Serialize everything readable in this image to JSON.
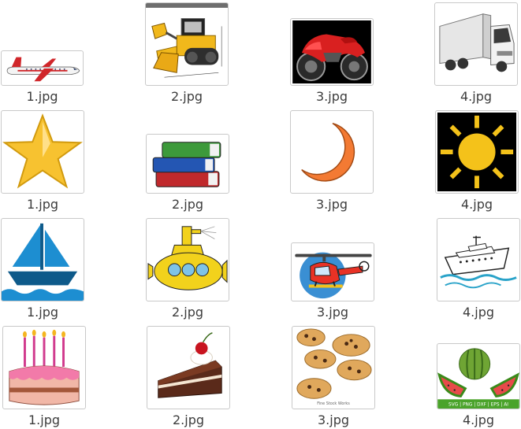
{
  "files": [
    {
      "name": "1.jpg",
      "icon": "airplane-icon"
    },
    {
      "name": "2.jpg",
      "icon": "bulldozer-icon"
    },
    {
      "name": "3.jpg",
      "icon": "motorcycle-icon"
    },
    {
      "name": "4.jpg",
      "icon": "truck-icon"
    },
    {
      "name": "1.jpg",
      "icon": "star-icon"
    },
    {
      "name": "2.jpg",
      "icon": "books-icon"
    },
    {
      "name": "3.jpg",
      "icon": "moon-icon"
    },
    {
      "name": "4.jpg",
      "icon": "sun-icon"
    },
    {
      "name": "1.jpg",
      "icon": "sailboat-icon"
    },
    {
      "name": "2.jpg",
      "icon": "submarine-icon"
    },
    {
      "name": "3.jpg",
      "icon": "helicopter-icon"
    },
    {
      "name": "4.jpg",
      "icon": "cruise-ship-icon"
    },
    {
      "name": "1.jpg",
      "icon": "birthday-cake-icon"
    },
    {
      "name": "2.jpg",
      "icon": "cake-slice-icon"
    },
    {
      "name": "3.jpg",
      "icon": "cookies-icon"
    },
    {
      "name": "4.jpg",
      "icon": "watermelon-icon"
    }
  ],
  "stock_caption": "Fine Stock Works",
  "watermelon_formats": "SVG | PNG | DXF | EPS | AI"
}
